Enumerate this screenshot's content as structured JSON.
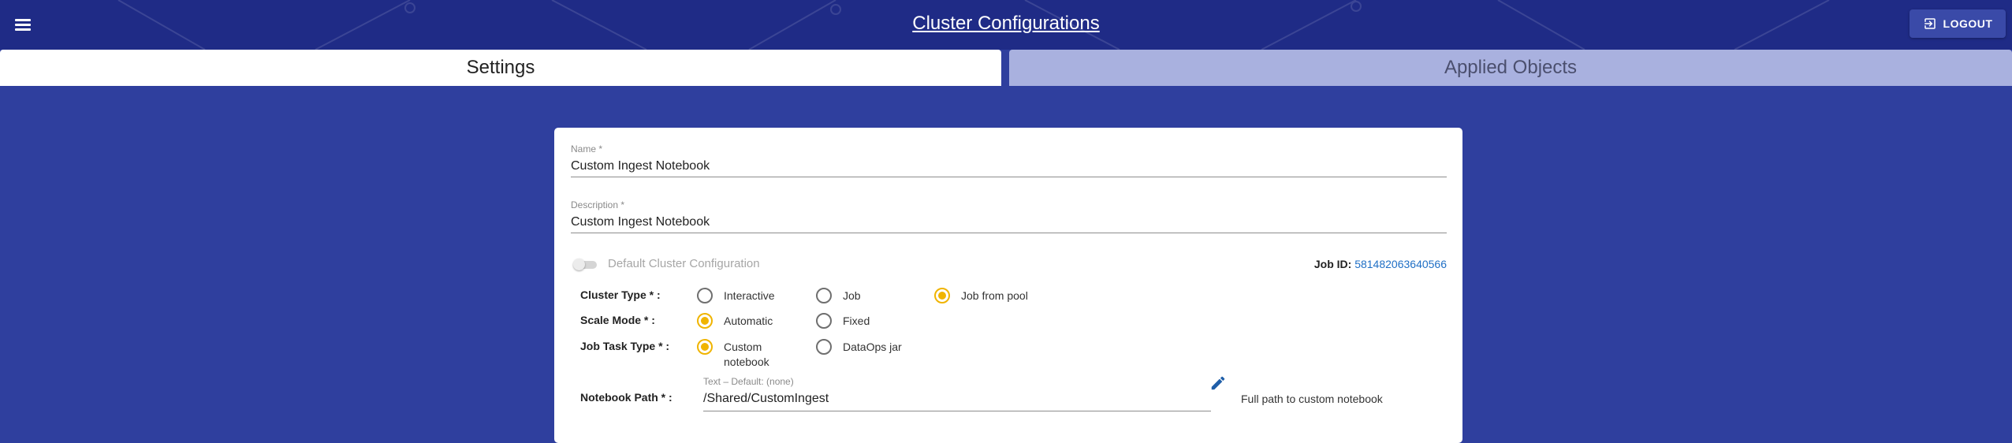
{
  "header": {
    "title": "Cluster Configurations",
    "menu_icon": "menu-icon",
    "logout_label": "LOGOUT",
    "logout_icon": "logout-icon",
    "background_color": "#1f2b86"
  },
  "tabs": [
    {
      "label": "Settings",
      "active": true
    },
    {
      "label": "Applied Objects",
      "active": false
    }
  ],
  "form": {
    "name": {
      "label": "Name *",
      "value": "Custom Ingest Notebook"
    },
    "description": {
      "label": "Description *",
      "value": "Custom Ingest Notebook"
    },
    "default_toggle": {
      "label": "Default Cluster Configuration",
      "on": false
    },
    "job_id": {
      "label": "Job ID:",
      "value": "581482063640566"
    },
    "cluster_type": {
      "label": "Cluster Type * :",
      "options": [
        "Interactive",
        "Job",
        "Job from pool"
      ],
      "selected": "Job from pool"
    },
    "scale_mode": {
      "label": "Scale Mode * :",
      "options": [
        "Automatic",
        "Fixed"
      ],
      "selected": "Automatic"
    },
    "job_task_type": {
      "label": "Job Task Type * :",
      "options": [
        "Custom notebook",
        "DataOps jar"
      ],
      "selected": "Custom notebook"
    },
    "notebook_path": {
      "label": "Notebook Path * :",
      "field_hint": "Text – Default: (none)",
      "value": "/Shared/CustomIngest",
      "help": "Full path to custom notebook",
      "edit_icon": "pencil-icon"
    }
  },
  "colors": {
    "page_background": "#2f3f9e",
    "accent_radio": "#f0b400",
    "link": "#1f6fc5"
  }
}
